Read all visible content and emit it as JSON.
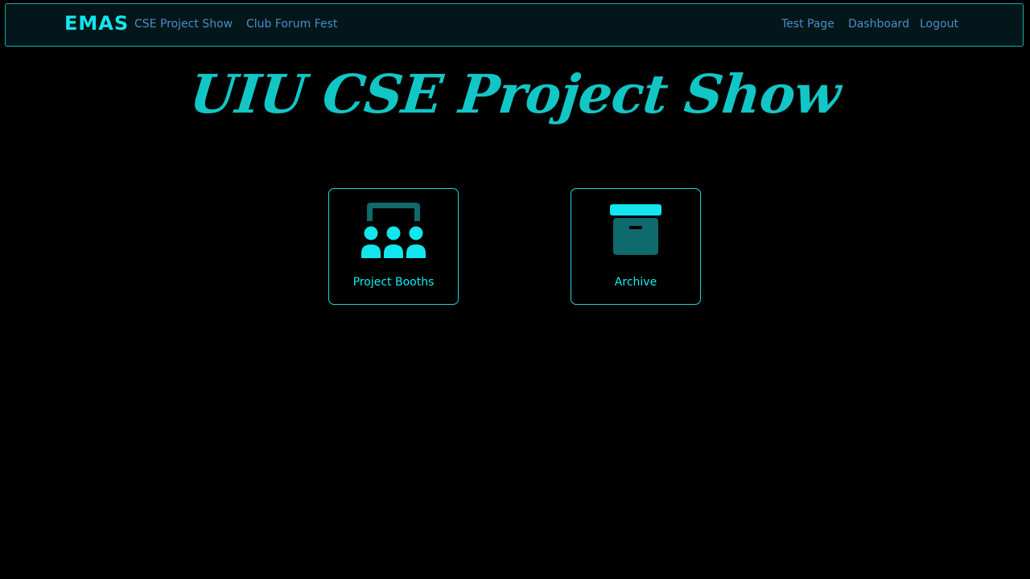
{
  "navbar": {
    "brand": "EMAS",
    "left_links": [
      "CSE Project Show",
      "Club Forum Fest"
    ],
    "right_links": [
      "Test Page",
      "Dashboard",
      "Logout"
    ]
  },
  "page": {
    "title": "UIU CSE Project Show"
  },
  "cards": [
    {
      "label": "Project Booths",
      "icon": "people-group-icon"
    },
    {
      "label": "Archive",
      "icon": "archive-box-icon"
    }
  ],
  "colors": {
    "background": "#000000",
    "navbar_bg": "#03171a",
    "accent": "#12e6ee",
    "title": "#12c6c6",
    "link": "#4a8ccc",
    "icon_dark": "#0e6a6c"
  }
}
